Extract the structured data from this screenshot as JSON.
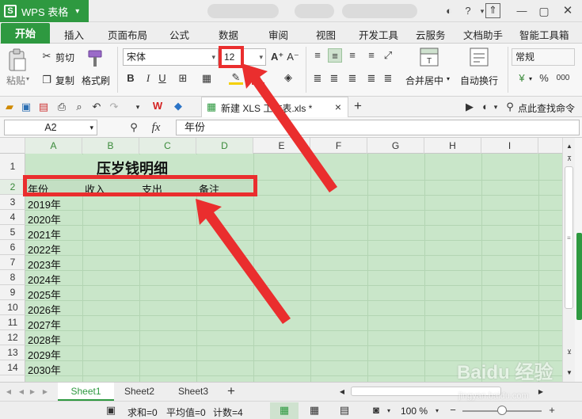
{
  "app": {
    "name": "WPS 表格",
    "caret": "▾"
  },
  "tabs": [
    "开始",
    "插入",
    "页面布局",
    "公式",
    "数据",
    "审阅",
    "视图",
    "开发工具",
    "云服务",
    "文档助手",
    "智能工具箱"
  ],
  "ribbon": {
    "paste": "粘贴",
    "cut": "剪切",
    "copy": "复制",
    "format_painter": "格式刷",
    "font_name": "宋体",
    "font_size": "12",
    "merge_center": "合并居中",
    "wrap_text": "自动换行",
    "number_format": "常规",
    "percent": "%"
  },
  "quick": {
    "doc_name": "新建 XLS 工作表.xls *",
    "close": "×",
    "add": "+",
    "search": "点此查找命令"
  },
  "formula_bar": {
    "name_box": "A2",
    "fx": "fx",
    "formula": "年份"
  },
  "grid": {
    "columns": [
      "A",
      "B",
      "C",
      "D",
      "E",
      "F",
      "G",
      "H",
      "I"
    ],
    "rows": [
      "1",
      "2",
      "3",
      "4",
      "5",
      "6",
      "7",
      "8",
      "9",
      "10",
      "11",
      "12",
      "13",
      "14"
    ],
    "title": "压岁钱明细",
    "headers": [
      "年份",
      "收入",
      "支出",
      "备注"
    ],
    "years": [
      "2019年",
      "2020年",
      "2021年",
      "2022年",
      "2023年",
      "2024年",
      "2025年",
      "2026年",
      "2027年",
      "2028年",
      "2029年",
      "2030年"
    ]
  },
  "sheets": [
    "Sheet1",
    "Sheet2",
    "Sheet3"
  ],
  "status": {
    "sum": "求和=0",
    "average": "平均值=0",
    "count": "计数=4",
    "zoom": "100 %"
  },
  "watermark": {
    "brand": "Baidu 经验",
    "url": "jingyan.baidu.com"
  },
  "colors": {
    "accent": "#2e9940",
    "sheet_bg": "#c9e6c9",
    "annotation": "#ea2e2e"
  }
}
